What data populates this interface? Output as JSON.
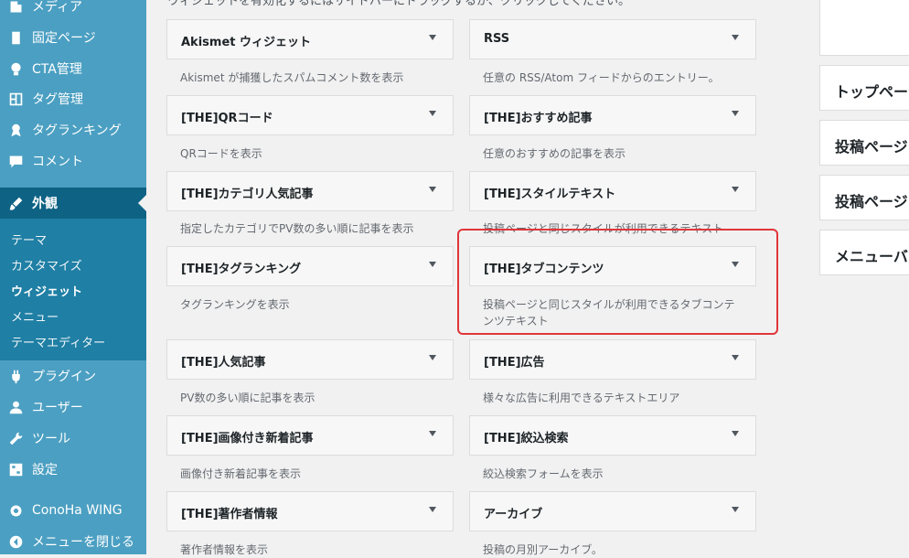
{
  "sidebar": {
    "items": [
      {
        "label": "メディア",
        "icon": "media-icon"
      },
      {
        "label": "固定ページ",
        "icon": "page-icon"
      },
      {
        "label": "CTA管理",
        "icon": "lightbulb-icon"
      },
      {
        "label": "タグ管理",
        "icon": "layout-icon"
      },
      {
        "label": "タグランキング",
        "icon": "award-icon"
      },
      {
        "label": "コメント",
        "icon": "comment-icon"
      },
      {
        "label": "外観",
        "icon": "brush-icon"
      },
      {
        "label": "プラグイン",
        "icon": "plugin-icon"
      },
      {
        "label": "ユーザー",
        "icon": "user-icon"
      },
      {
        "label": "ツール",
        "icon": "wrench-icon"
      },
      {
        "label": "設定",
        "icon": "settings-icon"
      },
      {
        "label": "ConoHa WING",
        "icon": "gear-icon"
      },
      {
        "label": "メニューを閉じる",
        "icon": "collapse-icon"
      }
    ],
    "submenu": [
      "テーマ",
      "カスタマイズ",
      "ウィジェット",
      "メニュー",
      "テーマエディター"
    ]
  },
  "top_hint": "ウィジェットを有効化するにはサイドバーにドラッグするか、クリックしてください。",
  "widgets": [
    {
      "title": "Akismet ウィジェット",
      "desc": "Akismet が捕獲したスパムコメント数を表示"
    },
    {
      "title": "RSS",
      "desc": "任意の RSS/Atom フィードからのエントリー。"
    },
    {
      "title": "[THE]QRコード",
      "desc": "QRコードを表示"
    },
    {
      "title": "[THE]おすすめ記事",
      "desc": "任意のおすすめの記事を表示"
    },
    {
      "title": "[THE]カテゴリ人気記事",
      "desc": "指定したカテゴリでPV数の多い順に記事を表示"
    },
    {
      "title": "[THE]スタイルテキスト",
      "desc": "投稿ページと同じスタイルが利用できるテキスト"
    },
    {
      "title": "[THE]タグランキング",
      "desc": "タグランキングを表示"
    },
    {
      "title": "[THE]タブコンテンツ",
      "desc": "投稿ページと同じスタイルが利用できるタブコンテンツテキスト"
    },
    {
      "title": "[THE]人気記事",
      "desc": "PV数の多い順に記事を表示"
    },
    {
      "title": "[THE]広告",
      "desc": "様々な広告に利用できるテキストエリア"
    },
    {
      "title": "[THE]画像付き新着記事",
      "desc": "画像付き新着記事を表示"
    },
    {
      "title": "[THE]絞込検索",
      "desc": "絞込検索フォームを表示"
    },
    {
      "title": "[THE]著作者情報",
      "desc": "著作者情報を表示"
    },
    {
      "title": "アーカイブ",
      "desc": "投稿の月別アーカイブ。"
    }
  ],
  "right_areas": [
    "トップページ",
    "投稿ページ",
    "投稿ページ",
    "メニューバー"
  ]
}
